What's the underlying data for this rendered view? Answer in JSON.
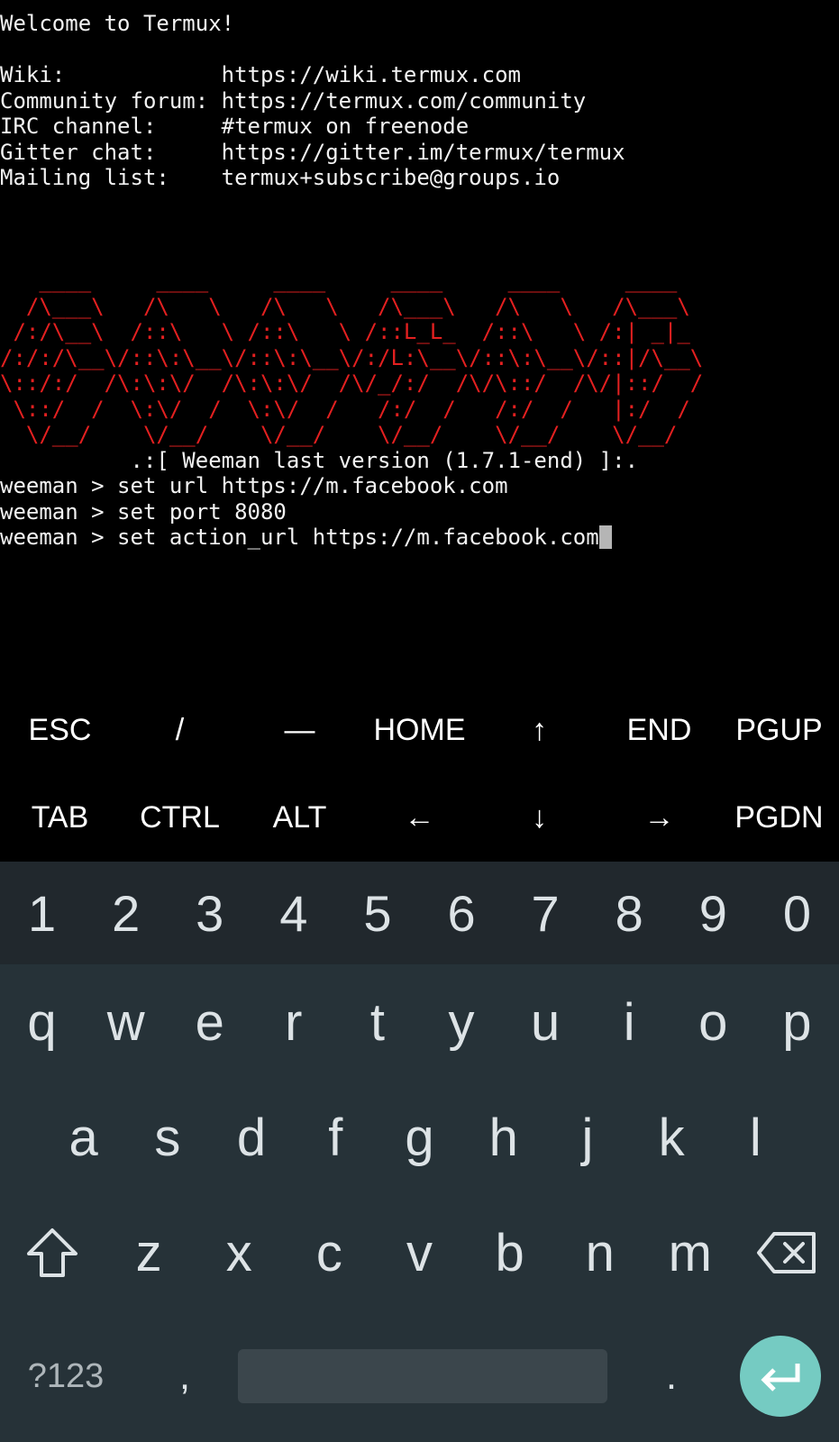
{
  "terminal": {
    "lines": [
      "Welcome to Termux!",
      "",
      "Wiki:            https://wiki.termux.com",
      "Community forum: https://termux.com/community",
      "IRC channel:     #termux on freenode",
      "Gitter chat:     https://gitter.im/termux/termux",
      "Mailing list:    termux+subscribe@groups.io"
    ],
    "banner": [
      "   ____     ____     ____     ____     ____     ____ ",
      "  /\\___\\   /\\   \\   /\\   \\   /\\___\\   /\\   \\   /\\___\\",
      " /:/\\__\\  /::\\   \\ /::\\   \\ /::L_L_  /::\\   \\ /:| _|_",
      "/:/:/\\__\\/::\\:\\__\\/::\\:\\__\\/:/L:\\__\\/::\\:\\__\\/::|/\\__\\",
      "\\::/:/  /\\:\\:\\/  /\\:\\:\\/  /\\/_/:/  /\\/\\::/  /\\/|::/  /",
      " \\::/  /  \\:\\/  /  \\:\\/  /   /:/  /   /:/  /   |:/  /",
      "  \\/__/    \\/__/    \\/__/    \\/__/    \\/__/    \\/__/"
    ],
    "version_line": "          .:[ Weeman last version (1.7.1-end) ]:.",
    "commands": [
      "weeman > set url https://m.facebook.com",
      "weeman > set port 8080",
      "weeman > set action_url https://m.facebook.com"
    ]
  },
  "extra_keys": {
    "row1": [
      "ESC",
      "/",
      "—",
      "HOME",
      "↑",
      "END",
      "PGUP"
    ],
    "row2": [
      "TAB",
      "CTRL",
      "ALT",
      "←",
      "↓",
      "→",
      "PGDN"
    ]
  },
  "keyboard": {
    "numbers": [
      "1",
      "2",
      "3",
      "4",
      "5",
      "6",
      "7",
      "8",
      "9",
      "0"
    ],
    "row_q": [
      "q",
      "w",
      "e",
      "r",
      "t",
      "y",
      "u",
      "i",
      "o",
      "p"
    ],
    "row_a": [
      "a",
      "s",
      "d",
      "f",
      "g",
      "h",
      "j",
      "k",
      "l"
    ],
    "row_z": [
      "z",
      "x",
      "c",
      "v",
      "b",
      "n",
      "m"
    ],
    "symbols_label": "?123",
    "comma": ",",
    "period": ".",
    "icons": {
      "shift": "shift-icon",
      "backspace": "backspace-icon",
      "enter": "enter-icon"
    },
    "colors": {
      "background": "#263238",
      "number_row": "#21282d",
      "enter": "#75cbc2",
      "banner": "#e32020"
    }
  }
}
